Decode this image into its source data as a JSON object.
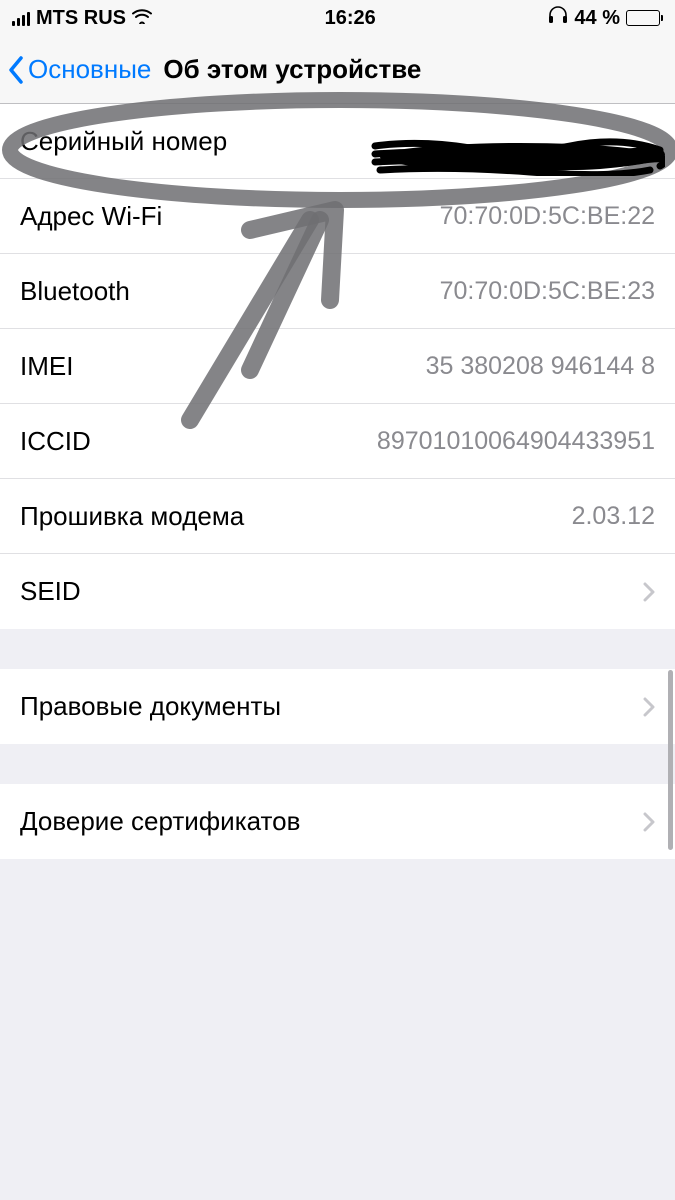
{
  "status": {
    "carrier": "MTS RUS",
    "time": "16:26",
    "battery_pct": "44 %"
  },
  "nav": {
    "back_label": "Основные",
    "title": "Об этом устройстве"
  },
  "rows": {
    "serial": {
      "label": "Серийный номер",
      "value": ""
    },
    "wifi": {
      "label": "Адрес Wi-Fi",
      "value": "70:70:0D:5C:BE:22"
    },
    "bt": {
      "label": "Bluetooth",
      "value": "70:70:0D:5C:BE:23"
    },
    "imei": {
      "label": "IMEI",
      "value": "35 380208 946144 8"
    },
    "iccid": {
      "label": "ICCID",
      "value": "89701010064904433951"
    },
    "modem": {
      "label": "Прошивка модема",
      "value": "2.03.12"
    },
    "seid": {
      "label": "SEID"
    },
    "legal": {
      "label": "Правовые документы"
    },
    "cert": {
      "label": "Доверие сертификатов"
    }
  }
}
